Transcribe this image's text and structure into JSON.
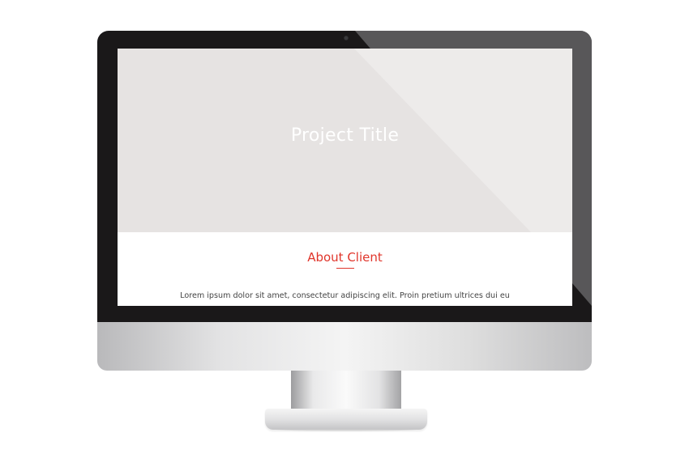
{
  "screen": {
    "hero": {
      "title": "Project Title"
    },
    "about": {
      "heading": "About Client",
      "body": "Lorem ipsum dolor sit amet, consectetur adipiscing elit. Proin pretium ultrices dui eu"
    }
  },
  "colors": {
    "accent": "#e0352b",
    "hero_background": "#e6e3e2",
    "bezel": "#1a1819"
  },
  "icons": {
    "camera": "camera-icon"
  }
}
